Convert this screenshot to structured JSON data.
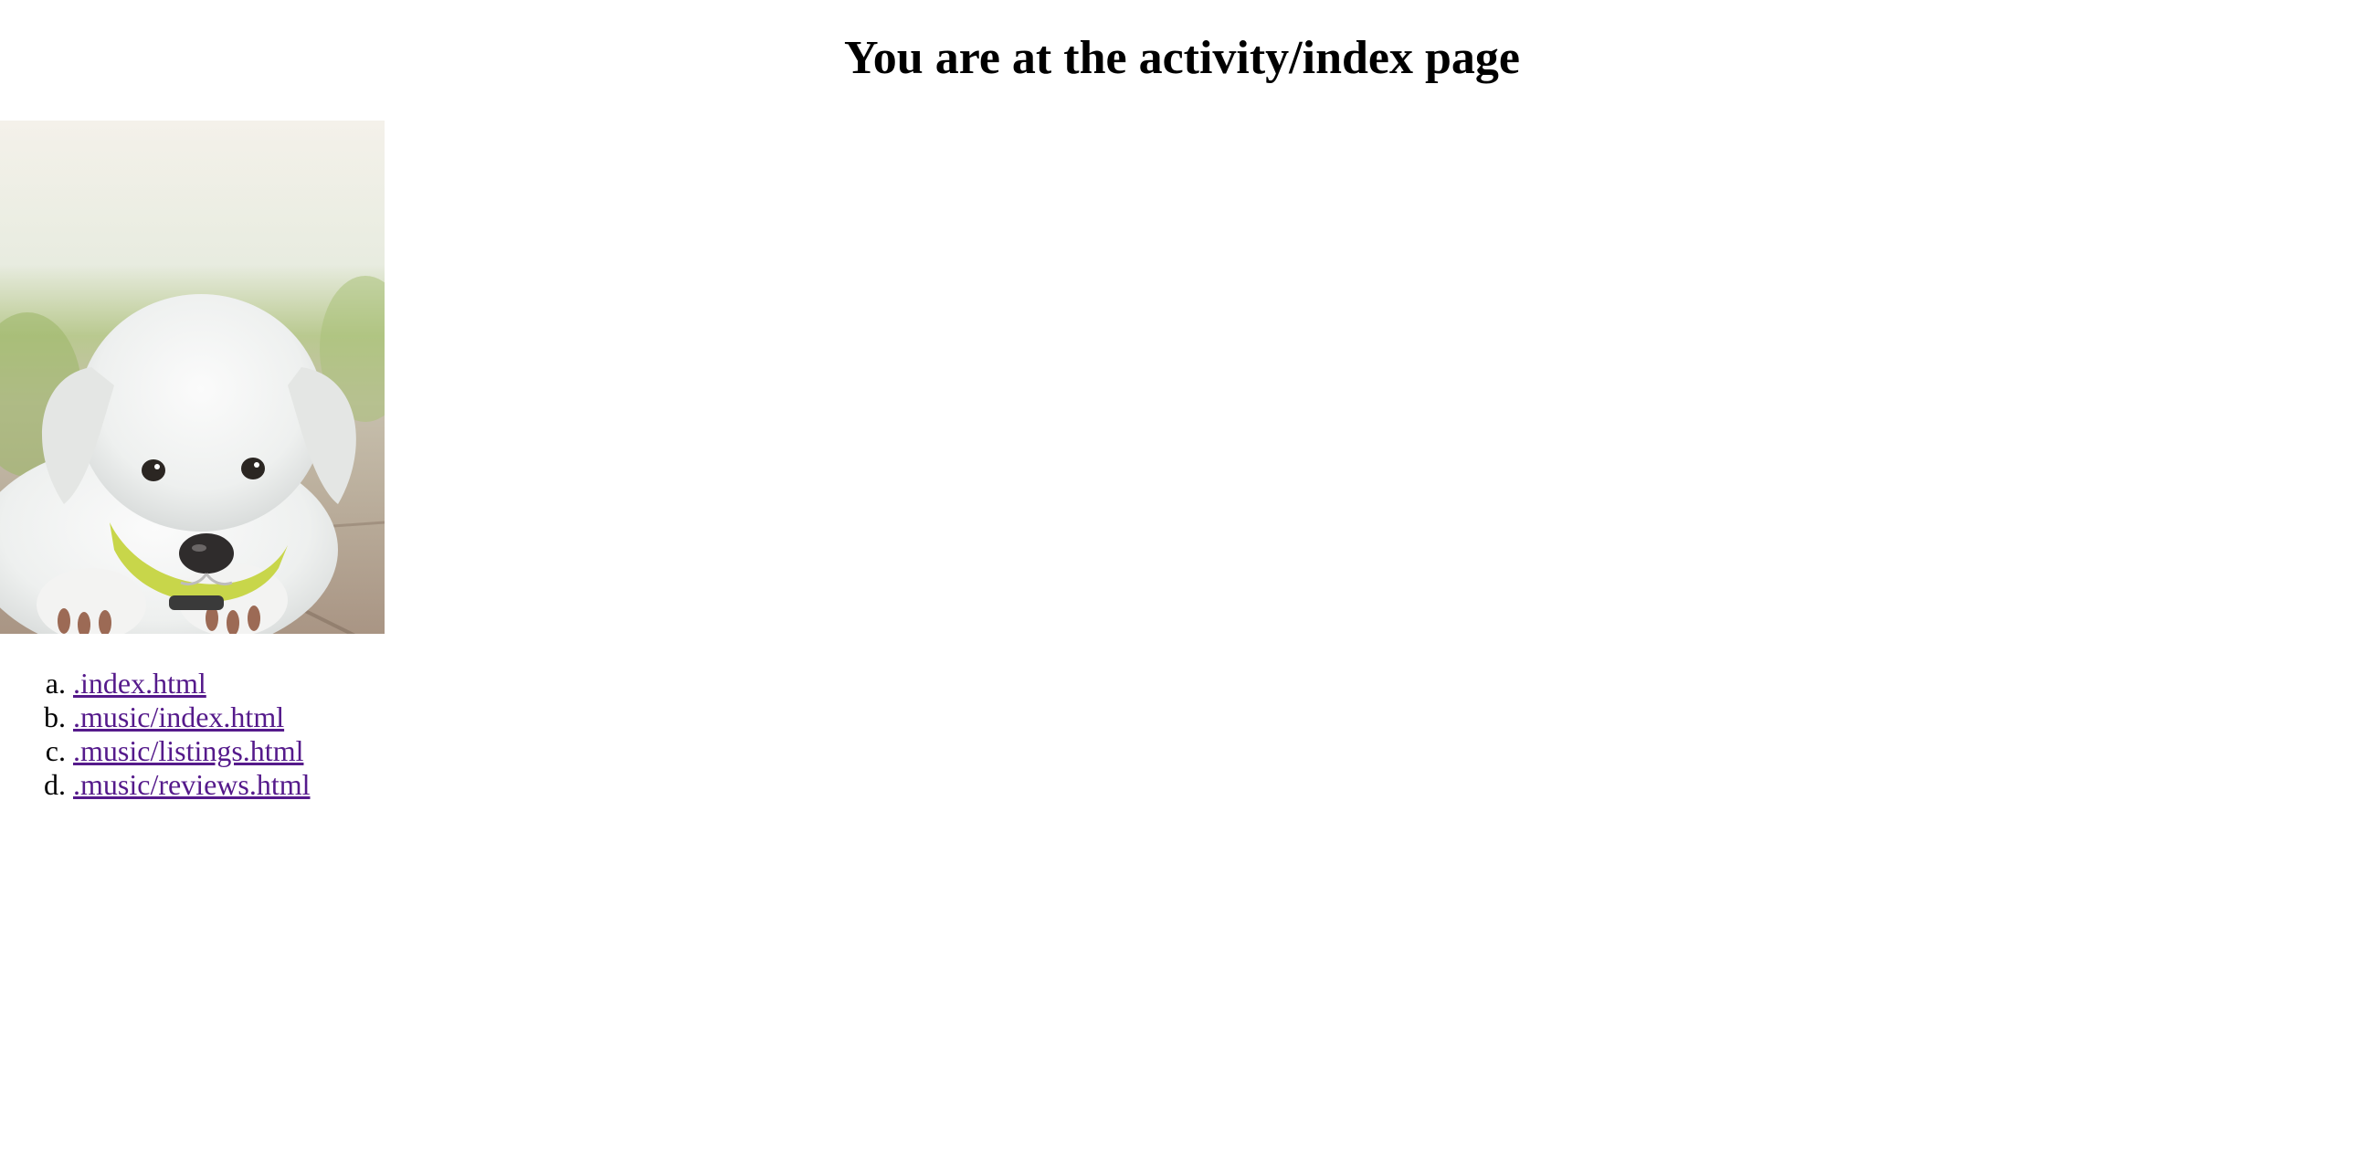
{
  "page": {
    "heading": "You are at the activity/index page"
  },
  "image": {
    "subject": "white puppy with yellow-green collar lying on a wooden deck",
    "icon": "puppy-photo"
  },
  "links": [
    {
      "marker": "a",
      "label": ".index.html",
      "href": ".index.html"
    },
    {
      "marker": "b",
      "label": ".music/index.html",
      "href": ".music/index.html"
    },
    {
      "marker": "c",
      "label": ".music/listings.html",
      "href": ".music/listings.html"
    },
    {
      "marker": "d",
      "label": ".music/reviews.html",
      "href": ".music/reviews.html"
    }
  ],
  "colors": {
    "link_visited": "#551a8b",
    "background": "#ffffff",
    "text": "#000000"
  }
}
